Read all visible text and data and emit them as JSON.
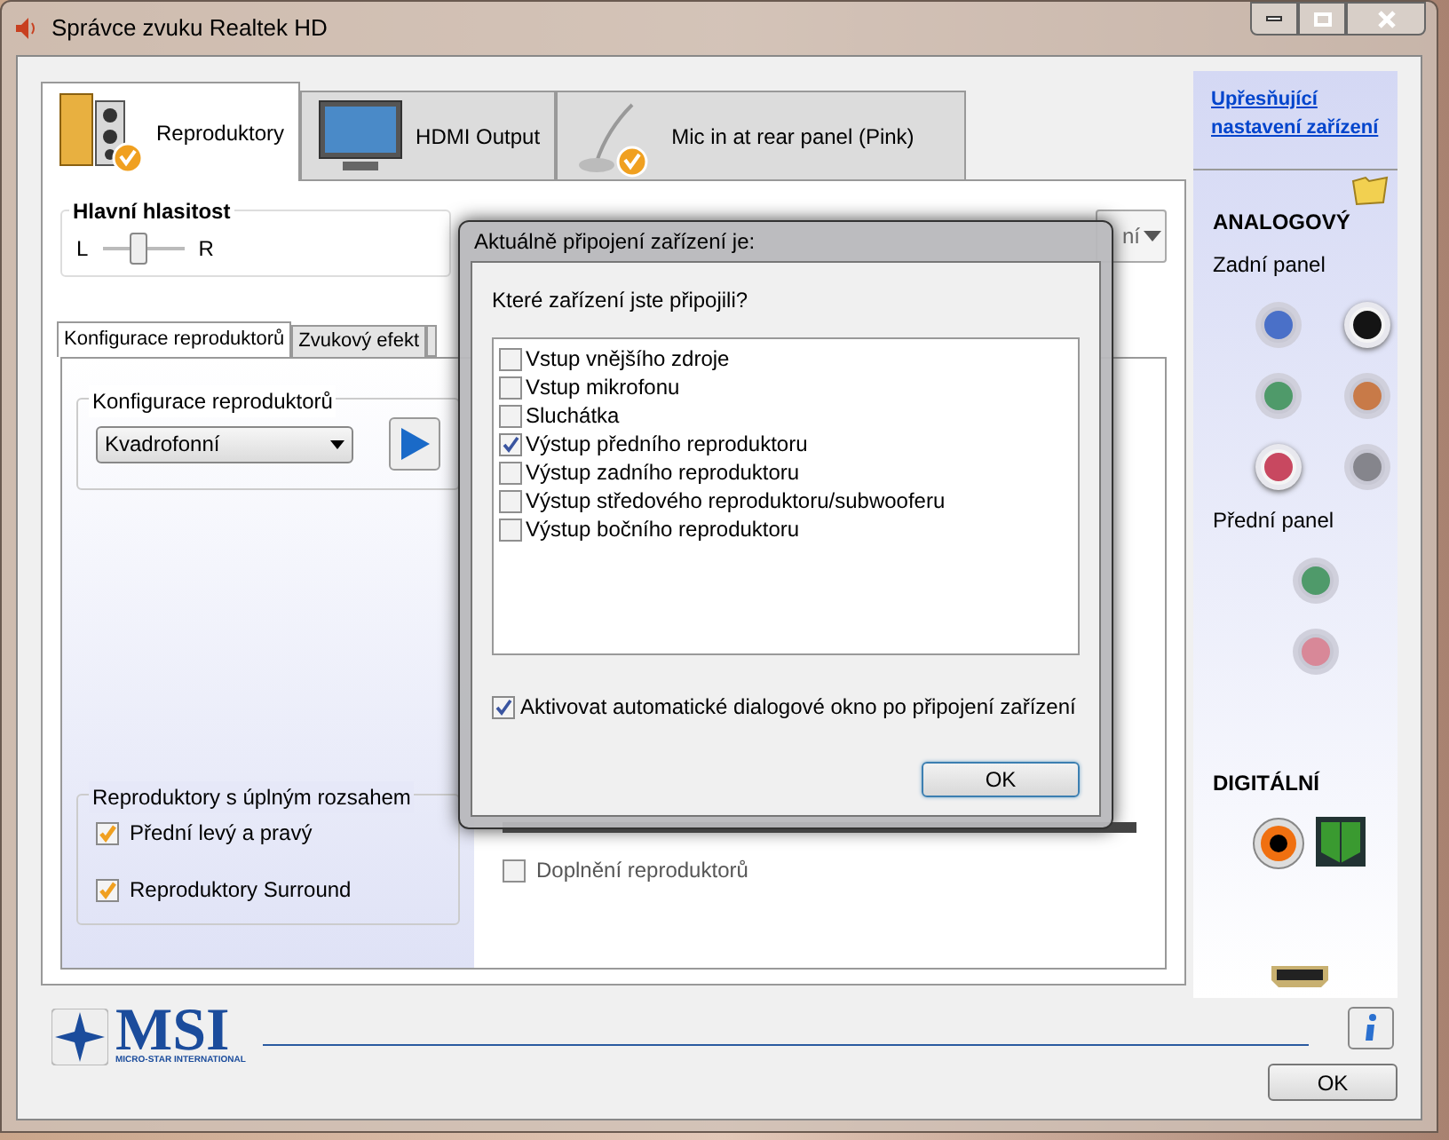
{
  "window": {
    "title": "Správce zvuku Realtek HD"
  },
  "device_tabs": [
    {
      "label": "Reproduktory",
      "kind": "speakers",
      "selected": true
    },
    {
      "label": "HDMI Output",
      "kind": "monitor",
      "selected": false
    },
    {
      "label": "Mic in at rear panel (Pink)",
      "kind": "mic",
      "selected": false
    }
  ],
  "advanced_link": "Upřesňující nastavení zařízení",
  "main_volume": {
    "label": "Hlavní hlasitost",
    "left": "L",
    "right": "R",
    "level": 0.45,
    "default_device_partial": "ní"
  },
  "sub_tabs": [
    {
      "label": "Konfigurace reproduktorů",
      "selected": true
    },
    {
      "label": "Zvukový efekt",
      "selected": false
    }
  ],
  "config_group": {
    "title": "Konfigurace reproduktorů",
    "value": "Kvadrofonní"
  },
  "fullrange_group": {
    "title": "Reproduktory s úplným rozsahem",
    "items": [
      {
        "label": "Přední levý a pravý",
        "checked": true
      },
      {
        "label": "Reproduktory Surround",
        "checked": true
      }
    ]
  },
  "virtual_surround": {
    "label": "Doplnění reproduktorů",
    "checked": false,
    "disabled": true
  },
  "sidebar": {
    "analog_title": "ANALOGOVÝ",
    "rear_title": "Zadní panel",
    "rear_jacks": [
      {
        "color": "#4a70c8",
        "active": false
      },
      {
        "color": "#141414",
        "active": true
      },
      {
        "color": "#4f9a6a",
        "active": false
      },
      {
        "color": "#c87a48",
        "active": false
      },
      {
        "color": "#c84860",
        "active": true
      },
      {
        "color": "#85858c",
        "active": false
      }
    ],
    "front_title": "Přední panel",
    "front_jacks": [
      {
        "color": "#4f9a6a",
        "active": false
      },
      {
        "color": "#d88898",
        "active": false
      }
    ],
    "digital_title": "DIGITÁLNÍ"
  },
  "logo": {
    "name": "MSI",
    "tagline": "MICRO-STAR INTERNATIONAL"
  },
  "ok_button": "OK",
  "dialog": {
    "title": "Aktuálně připojení zařízení je:",
    "question": "Které zařízení jste připojili?",
    "options": [
      {
        "label": "Vstup vnějšího zdroje",
        "checked": false
      },
      {
        "label": "Vstup mikrofonu",
        "checked": false
      },
      {
        "label": "Sluchátka",
        "checked": false
      },
      {
        "label": "Výstup předního reproduktoru",
        "checked": true
      },
      {
        "label": "Výstup zadního reproduktoru",
        "checked": false
      },
      {
        "label": "Výstup středového reproduktoru/subwooferu",
        "checked": false
      },
      {
        "label": "Výstup bočního reproduktoru",
        "checked": false
      }
    ],
    "auto_popup": {
      "label": "Aktivovat automatické dialogové okno po připojení zařízení",
      "checked": true
    },
    "ok": "OK"
  }
}
